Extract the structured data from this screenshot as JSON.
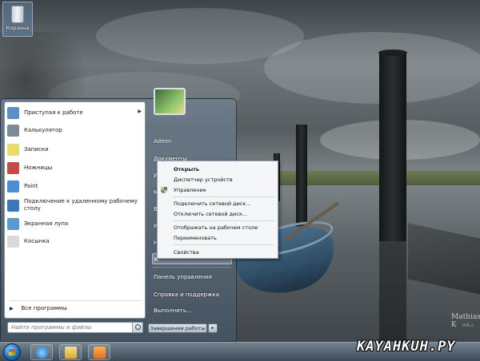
{
  "desktop": {
    "recycle_bin_label": "Корзина",
    "watermark_name": "Mathias K",
    "watermark_sub": "mk.c"
  },
  "start_menu": {
    "programs": [
      {
        "label": "Приступая к работе",
        "icon": "getting-started-icon",
        "color": "#5b8fc7",
        "has_submenu": true
      },
      {
        "label": "Калькулятор",
        "icon": "calculator-icon",
        "color": "#7c8a98",
        "has_submenu": false
      },
      {
        "label": "Записки",
        "icon": "sticky-notes-icon",
        "color": "#e8dc6a",
        "has_submenu": false
      },
      {
        "label": "Ножницы",
        "icon": "snipping-tool-icon",
        "color": "#c84848",
        "has_submenu": false
      },
      {
        "label": "Paint",
        "icon": "paint-icon",
        "color": "#4a8fd6",
        "has_submenu": false
      },
      {
        "label": "Подключение к удаленному рабочему столу",
        "icon": "remote-desktop-icon",
        "color": "#3c78b8",
        "has_submenu": false
      },
      {
        "label": "Экранная лупа",
        "icon": "magnifier-icon",
        "color": "#5a9ad0",
        "has_submenu": false
      },
      {
        "label": "Косынка",
        "icon": "solitaire-icon",
        "color": "#d9d9d9",
        "has_submenu": false
      }
    ],
    "all_programs": "Все программы",
    "search_placeholder": "Найти программы и файлы",
    "right_items": [
      "Admin",
      "Документы",
      "И",
      "М",
      "В",
      "И",
      "Н",
      "И",
      "К",
      "Панель управления",
      "Справка и поддержка",
      "Выполнить..."
    ],
    "shutdown_label": "Завершение работы",
    "shutdown_arrow": "▸"
  },
  "context_menu": {
    "items": [
      "Открыть",
      "Диспетчер устройств",
      "Управление",
      "Подключить сетевой диск...",
      "Отключить сетевой диск...",
      "Отображать на рабочем столе",
      "Переименовать",
      "Свойства"
    ]
  },
  "taskbar": {
    "pinned": [
      "ie-icon",
      "explorer-folder-icon",
      "media-player-icon"
    ]
  },
  "watermark_site": "KAYAHKUH.PY"
}
